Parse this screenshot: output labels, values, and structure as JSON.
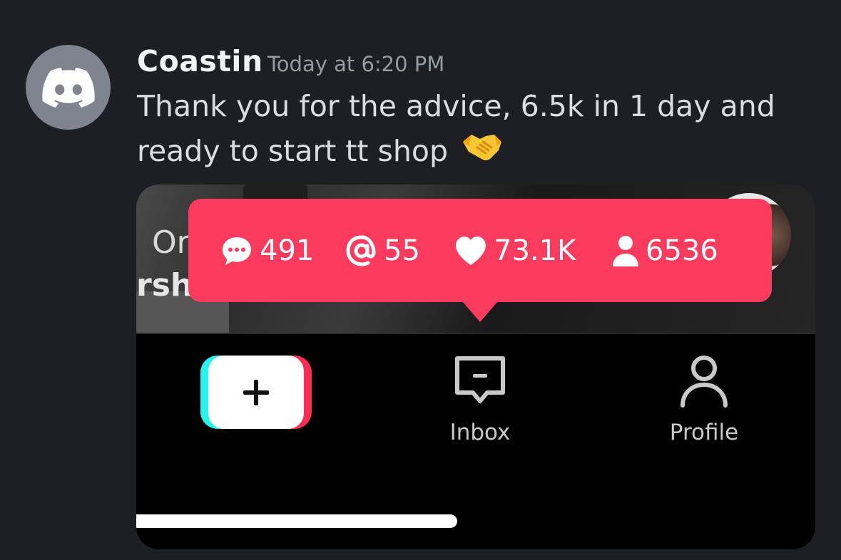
{
  "message": {
    "username": "Coastin",
    "timestamp": "Today at 6:20 PM",
    "text": "Thank you for the advice, 6.5k in 1 day and ready to start tt shop",
    "emoji": "handshake",
    "avatar_icon": "discord-logo-icon"
  },
  "attachment": {
    "background_text_line1": "Or",
    "background_text_line2": "rshi",
    "stats": [
      {
        "icon": "comment-icon",
        "value": "491"
      },
      {
        "icon": "mention-icon",
        "value": "55"
      },
      {
        "icon": "heart-icon",
        "value": "73.1K"
      },
      {
        "icon": "person-icon",
        "value": "6536"
      }
    ],
    "nav": {
      "create_icon": "plus-icon",
      "inbox_label": "Inbox",
      "profile_label": "Profile"
    }
  },
  "colors": {
    "discord_bg": "#1e1f24",
    "tooltip_red": "#fb3b5d",
    "tiktok_cyan": "#25f4ee",
    "tiktok_red": "#fe2c55"
  }
}
